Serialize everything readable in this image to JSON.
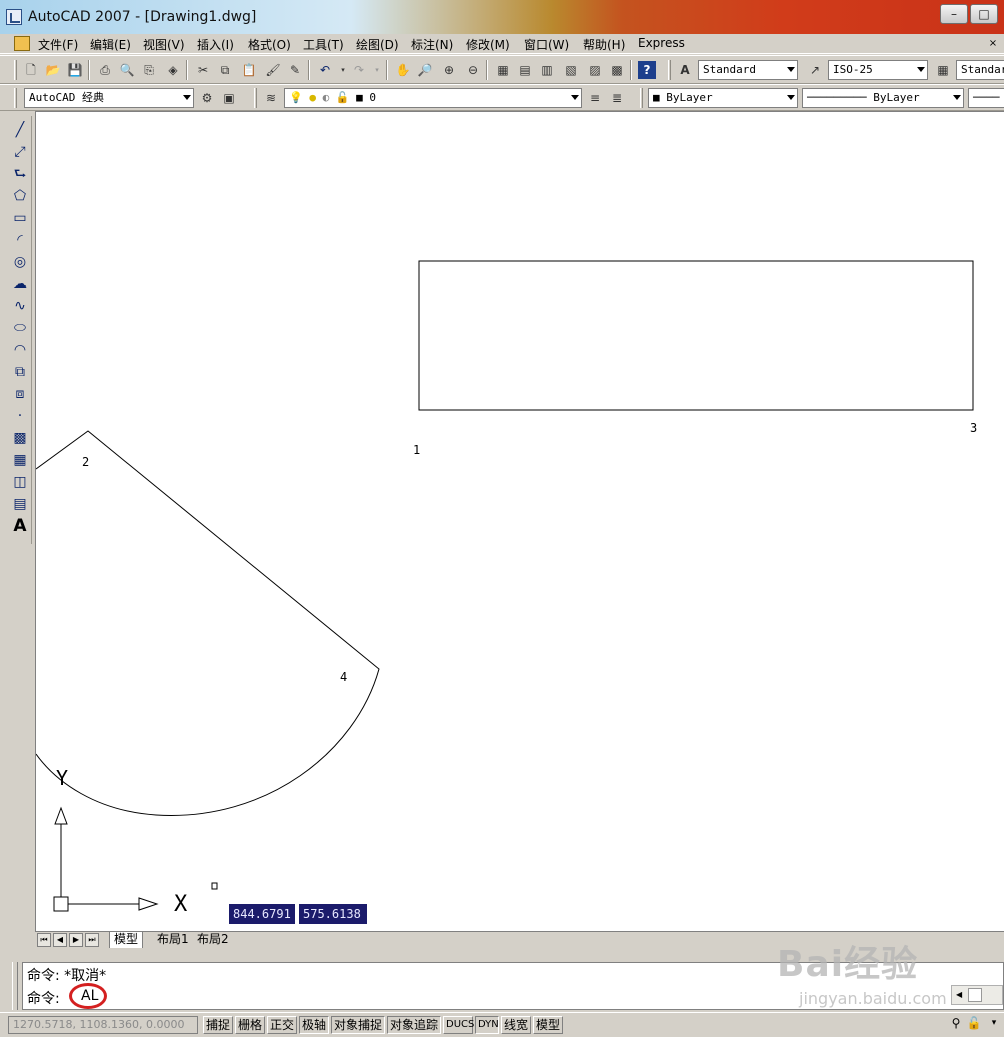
{
  "window": {
    "title": "AutoCAD 2007 - [Drawing1.dwg]"
  },
  "menus": [
    "文件(F)",
    "编辑(E)",
    "视图(V)",
    "插入(I)",
    "格式(O)",
    "工具(T)",
    "绘图(D)",
    "标注(N)",
    "修改(M)",
    "窗口(W)",
    "帮助(H)",
    "Express"
  ],
  "toolbar": {
    "text_style": "Standard",
    "dim_style": "ISO-25",
    "table_style": "Standar",
    "workspace": "AutoCAD 经典",
    "layer": "0",
    "color": "ByLayer",
    "linetype": "ByLayer"
  },
  "drawing": {
    "labels": [
      "1",
      "2",
      "3",
      "4"
    ],
    "ucs_x": "X",
    "ucs_y": "Y",
    "dyn_x": "844.6791",
    "dyn_y": "575.6138"
  },
  "tabs": [
    "模型",
    "布局1",
    "布局2"
  ],
  "command": {
    "history": "命令: *取消*",
    "prompt": "命令:",
    "input": "AL"
  },
  "status": {
    "coords": "1270.5718,  1108.1360,  0.0000",
    "toggles": [
      "捕捉",
      "栅格",
      "正交",
      "极轴",
      "对象捕捉",
      "对象追踪",
      "DUCS",
      "DYN",
      "线宽",
      "模型"
    ]
  },
  "watermark": {
    "brand": "Bai经验",
    "url": "jingyan.baidu.com"
  },
  "colors": {
    "highlight_circle": "#d42020",
    "tooltip_bg": "#1b1b6b"
  }
}
